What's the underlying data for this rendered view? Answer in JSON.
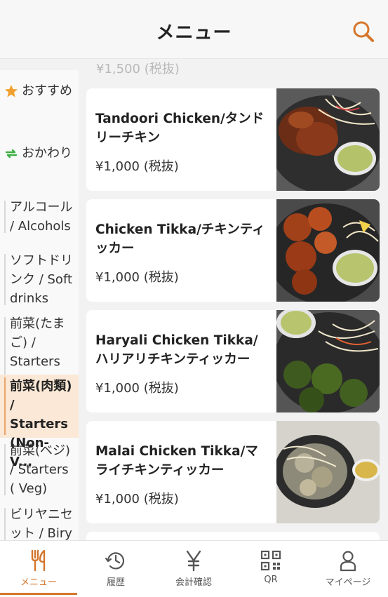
{
  "header": {
    "title": "メニュー",
    "search_icon": "search-icon"
  },
  "sidebar": {
    "recommend": "おすすめ",
    "refill": "おかわり",
    "categories": [
      {
        "label": "アルコール / Alcohols"
      },
      {
        "label": "ソフトドリンク / Soft drinks"
      },
      {
        "label": "前菜(たまご) / Starters Eggs"
      },
      {
        "label": "前菜(肉類) / Starters (Non- V..."
      },
      {
        "label": "前菜(ベジ) / Starters ( Veg)"
      },
      {
        "label": "ビリヤニセット / Biry"
      }
    ]
  },
  "menu": {
    "previous_price": "¥1,500 (税抜)",
    "items": [
      {
        "name": "Tandoori Chicken/タンドリーチキン",
        "price": "¥1,000 (税抜)"
      },
      {
        "name": "Chicken Tikka/チキンティッカー",
        "price": "¥1,000 (税抜)"
      },
      {
        "name": "Haryali Chicken Tikka/ハリアリチキンティッカー",
        "price": "¥1,000 (税抜)"
      },
      {
        "name": "Malai Chicken Tikka/マライチキンティッカー",
        "price": "¥1,000 (税抜)"
      }
    ]
  },
  "tabs": [
    {
      "label": "メニュー",
      "icon": "fork-knife-icon"
    },
    {
      "label": "履歴",
      "icon": "history-icon"
    },
    {
      "label": "会計確認",
      "icon": "yen-icon"
    },
    {
      "label": "QR",
      "icon": "qr-icon"
    },
    {
      "label": "マイページ",
      "icon": "user-icon"
    }
  ],
  "colors": {
    "accent": "#d4762d",
    "active_category_bg": "#fbe8d6",
    "refill_green": "#3cb043",
    "star_orange": "#f0a030"
  }
}
